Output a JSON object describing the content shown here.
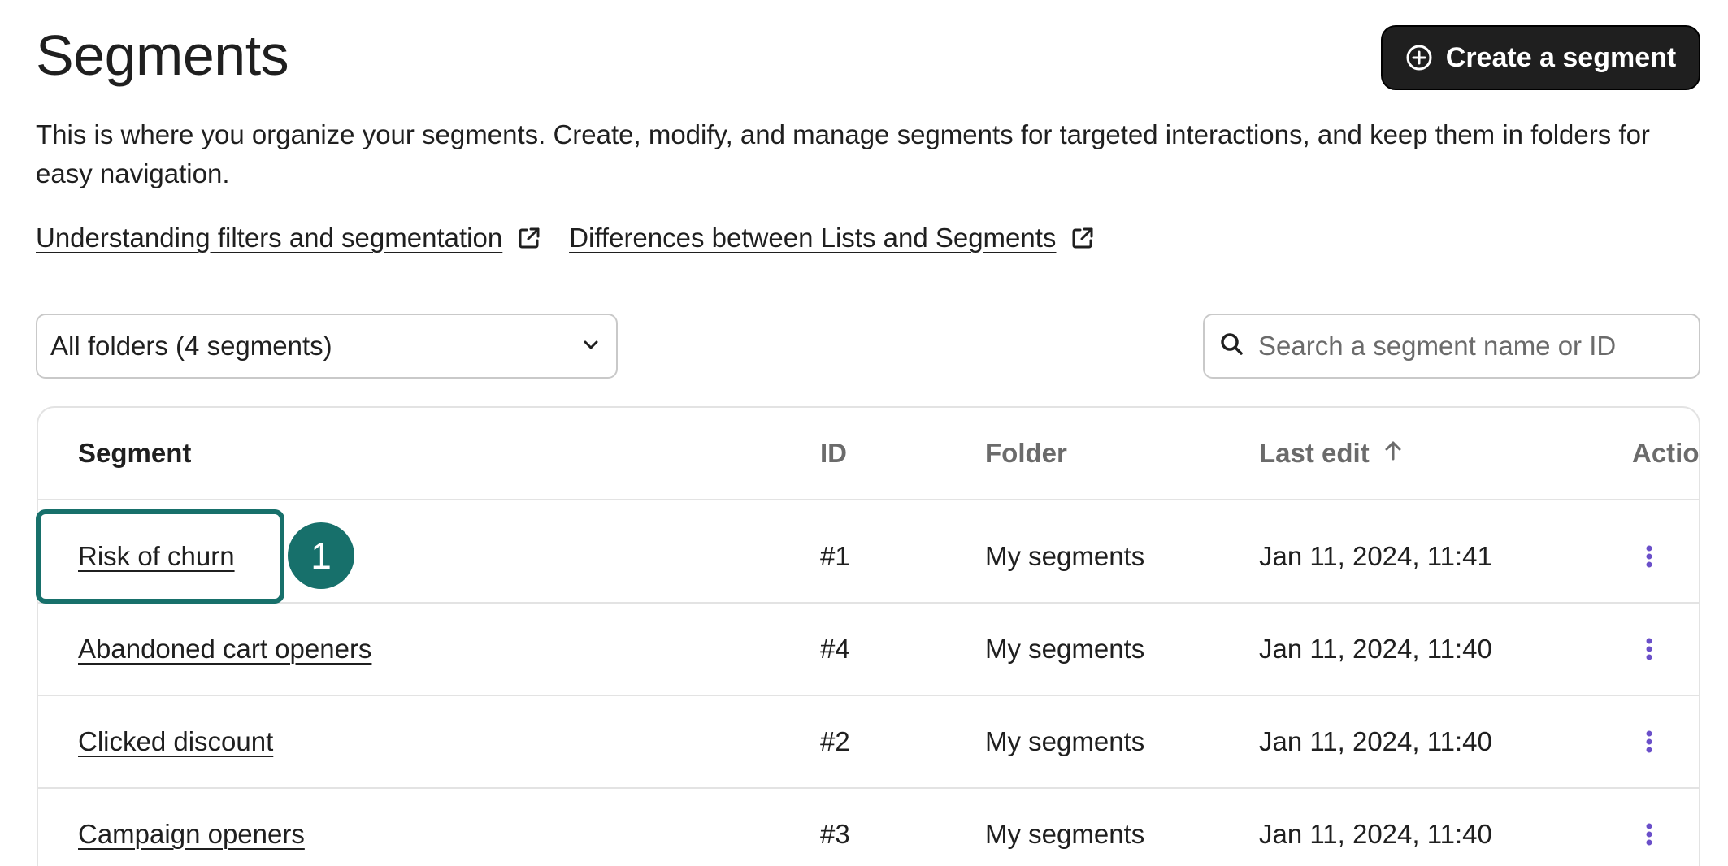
{
  "page": {
    "title": "Segments",
    "description": "This is where you organize your segments. Create, modify, and manage segments for targeted interactions, and keep them in folders for easy navigation."
  },
  "create_button": {
    "label": "Create a segment",
    "icon": "plus-circle-icon"
  },
  "help_links": [
    {
      "label": "Understanding filters and segmentation",
      "icon": "external-link-icon"
    },
    {
      "label": "Differences between Lists and Segments",
      "icon": "external-link-icon"
    }
  ],
  "folder_select": {
    "selected": "All folders (4 segments)",
    "icon": "chevron-down-icon"
  },
  "search": {
    "placeholder": "Search a segment name or ID",
    "value": "",
    "icon": "search-icon"
  },
  "table": {
    "columns": {
      "segment": "Segment",
      "id": "ID",
      "folder": "Folder",
      "last_edit": "Last edit",
      "actions": "Actio"
    },
    "sort": {
      "column": "last_edit",
      "direction": "ascending",
      "icon": "arrow-up-icon"
    },
    "rows": [
      {
        "segment": "Risk of churn",
        "id": "#1",
        "folder": "My segments",
        "last_edit": "Jan 11, 2024, 11:41"
      },
      {
        "segment": "Abandoned cart openers",
        "id": "#4",
        "folder": "My segments",
        "last_edit": "Jan 11, 2024, 11:40"
      },
      {
        "segment": "Clicked discount",
        "id": "#2",
        "folder": "My segments",
        "last_edit": "Jan 11, 2024, 11:40"
      },
      {
        "segment": "Campaign openers",
        "id": "#3",
        "folder": "My segments",
        "last_edit": "Jan 11, 2024, 11:40"
      }
    ]
  },
  "annotation": {
    "step_number": "1",
    "color": "#17706b"
  },
  "colors": {
    "primary_button": "#1f1f1f",
    "kebab": "#6a4fc9",
    "border": "#e3e3e3",
    "text": "#1f1f1f",
    "muted_text": "#6b6b6b"
  }
}
